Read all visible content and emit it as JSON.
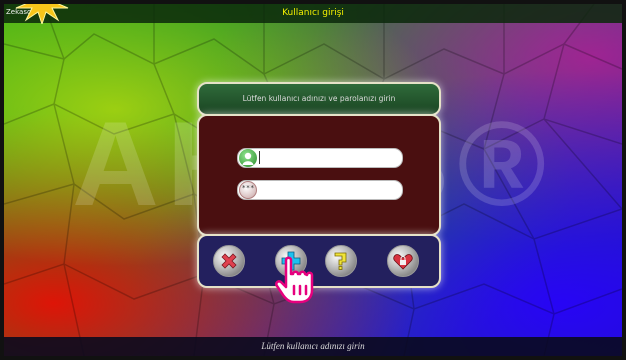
{
  "window": {
    "title": "Kullanıcı girişi",
    "brand": "Zekasoft",
    "watermark": "AHOB®"
  },
  "login": {
    "prompt": "Lütfen kullanıcı adınızı ve parolanızı girin",
    "username": {
      "value": "",
      "icon": "user-icon"
    },
    "password": {
      "value": "",
      "icon": "password-icon",
      "icon_text": "***"
    }
  },
  "buttons": [
    {
      "name": "cancel-button",
      "icon": "close-icon",
      "color": "#e0414f"
    },
    {
      "name": "add-user-button",
      "icon": "plus-icon",
      "color": "#1cc0f0"
    },
    {
      "name": "password-hint-button",
      "icon": "question-icon",
      "color": "#f0e43a"
    },
    {
      "name": "lock-button",
      "icon": "lock-icon",
      "color": "#d8323f"
    }
  ],
  "status": {
    "text": "Lütfen kullanıcı adınızı girin"
  }
}
